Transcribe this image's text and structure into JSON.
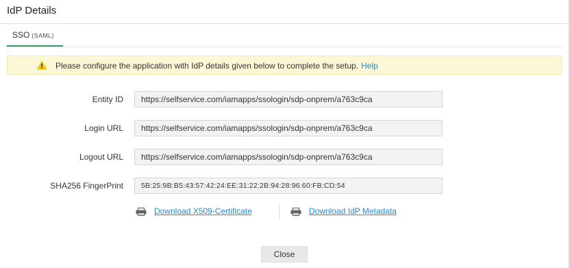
{
  "dialog": {
    "title": "IdP Details"
  },
  "tabs": [
    {
      "label": "SSO",
      "sublabel": "(SAML)",
      "active": true
    }
  ],
  "alert": {
    "icon": "warning-icon",
    "message": "Please configure the application with IdP details given below to complete the setup.",
    "help_link": "Help"
  },
  "fields": {
    "entity_id": {
      "label": "Entity ID",
      "value": "https://selfservice.com/iamapps/ssologin/sdp-onprem/a763c9ca"
    },
    "login_url": {
      "label": "Login URL",
      "value": "https://selfservice.com/iamapps/ssologin/sdp-onprem/a763c9ca"
    },
    "logout_url": {
      "label": "Logout URL",
      "value": "https://selfservice.com/iamapps/ssologin/sdp-onprem/a763c9ca"
    },
    "fingerprint": {
      "label": "SHA256 FingerPrint",
      "value": "5B:25:9B:B5:43:57:42:24:EE:31:22:2B:94:28:96:60:FB:CD:54"
    }
  },
  "downloads": {
    "certificate": {
      "label": "Download X509-Certificate",
      "icon": "printer-download-icon"
    },
    "metadata": {
      "label": "Download IdP Metadata",
      "icon": "printer-download-icon"
    }
  },
  "footer": {
    "close_label": "Close"
  },
  "colors": {
    "accent": "#2ba160",
    "link": "#2a88c9",
    "alert_bg": "#fcf8d6",
    "warning": "#f2c40f"
  }
}
